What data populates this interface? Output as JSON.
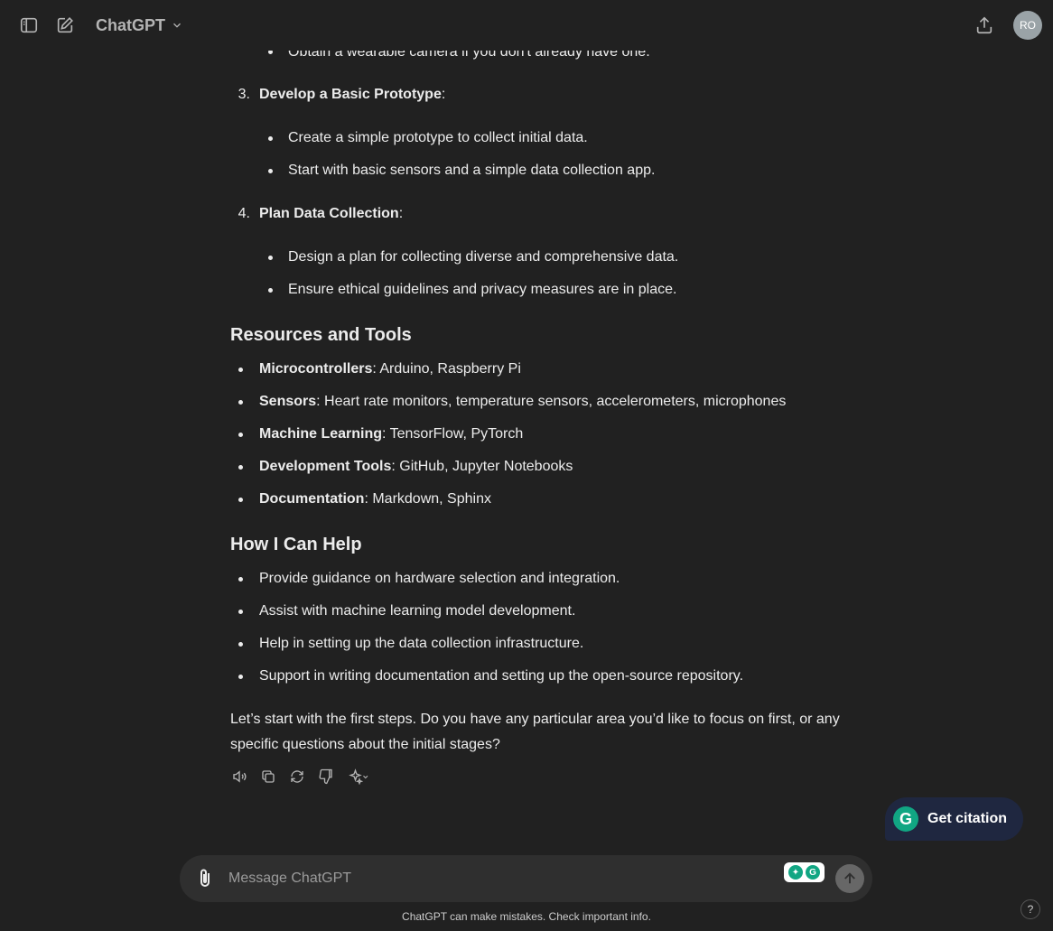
{
  "header": {
    "title": "ChatGPT",
    "avatar_initials": "RO"
  },
  "message": {
    "clipped_line": "Obtain a wearable camera if you don't already have one.",
    "steps": [
      {
        "number": "3.",
        "title": "Develop a Basic Prototype",
        "suffix": ":",
        "bullets": [
          "Create a simple prototype to collect initial data.",
          "Start with basic sensors and a simple data collection app."
        ]
      },
      {
        "number": "4.",
        "title": "Plan Data Collection",
        "suffix": ":",
        "bullets": [
          "Design a plan for collecting diverse and comprehensive data.",
          "Ensure ethical guidelines and privacy measures are in place."
        ]
      }
    ],
    "resources": {
      "heading": "Resources and Tools",
      "items": [
        {
          "label": "Microcontrollers",
          "text": ": Arduino, Raspberry Pi"
        },
        {
          "label": "Sensors",
          "text": ": Heart rate monitors, temperature sensors, accelerometers, microphones"
        },
        {
          "label": "Machine Learning",
          "text": ": TensorFlow, PyTorch"
        },
        {
          "label": "Development Tools",
          "text": ": GitHub, Jupyter Notebooks"
        },
        {
          "label": "Documentation",
          "text": ": Markdown, Sphinx"
        }
      ]
    },
    "help": {
      "heading": "How I Can Help",
      "items": [
        "Provide guidance on hardware selection and integration.",
        "Assist with machine learning model development.",
        "Help in setting up the data collection infrastructure.",
        "Support in writing documentation and setting up the open-source repository."
      ]
    },
    "closing_line1": "Let’s start with the first steps. Do you have any particular area you’d like to focus on first, or any",
    "closing_line2": "specific questions about the initial stages?"
  },
  "citation_button": "Get citation",
  "composer": {
    "placeholder": "Message ChatGPT"
  },
  "footer": {
    "disclaimer": "ChatGPT can make mistakes. Check important info.",
    "help_label": "?"
  },
  "icons": {
    "sidebar_toggle": "sidebar-toggle-icon",
    "new_chat": "new-chat-icon",
    "share": "share-icon",
    "read_aloud": "speaker-icon",
    "copy": "copy-icon",
    "regenerate": "regenerate-icon",
    "thumbs_down": "thumbs-down-icon",
    "model_sparkle": "sparkle-icon"
  }
}
